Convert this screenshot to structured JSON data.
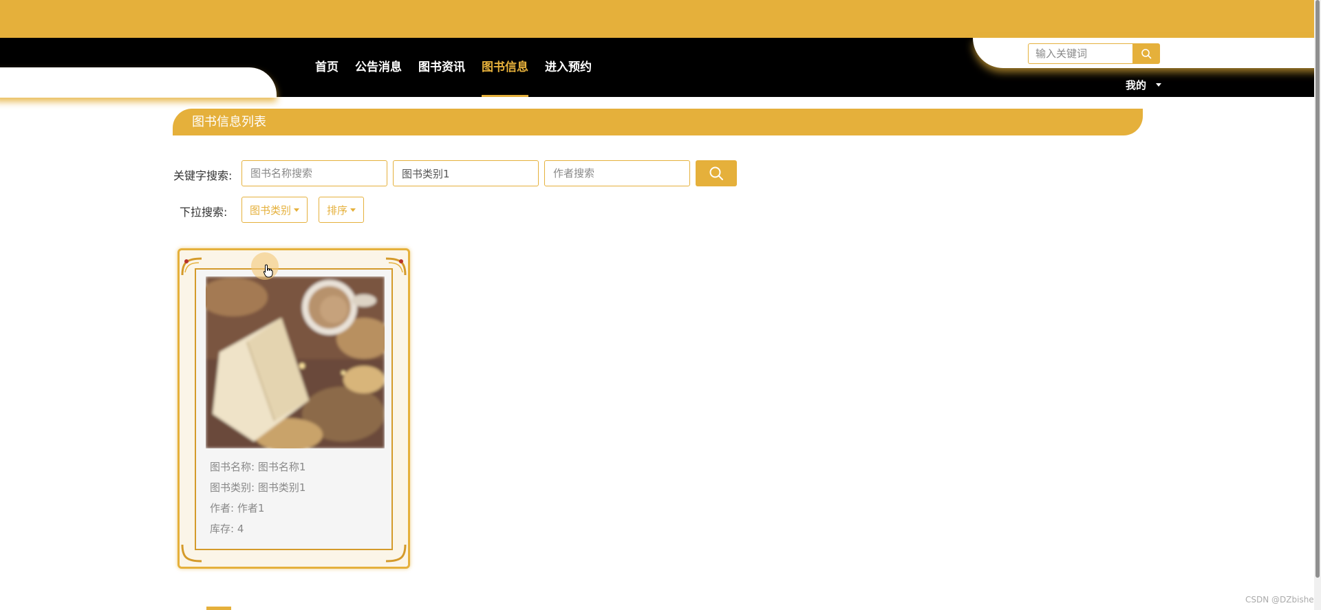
{
  "nav": {
    "items": [
      {
        "label": "首页"
      },
      {
        "label": "公告消息"
      },
      {
        "label": "图书资讯"
      },
      {
        "label": "图书信息"
      },
      {
        "label": "进入预约"
      }
    ],
    "active": "图书信息",
    "search_placeholder": "输入关键词",
    "mine_label": "我的"
  },
  "section": {
    "title": "图书信息列表"
  },
  "filters": {
    "keyword_label": "关键字搜索:",
    "name_placeholder": "图书名称搜索",
    "category_value": "图书类别1",
    "author_placeholder": "作者搜索",
    "dropdown_label": "下拉搜索:",
    "category_dropdown": "图书类别",
    "sort_dropdown": "排序"
  },
  "books": [
    {
      "name_line": "图书名称: 图书名称1",
      "category_line": "图书类别: 图书类别1",
      "author_line": "作者: 作者1",
      "stock_line": "库存: 4"
    }
  ],
  "watermark": "CSDN @DZbishe",
  "colors": {
    "accent": "#e5b03b",
    "nav_bg": "#000000"
  },
  "icons": {
    "search": "search-icon",
    "corner": "ornament-corner-icon"
  }
}
